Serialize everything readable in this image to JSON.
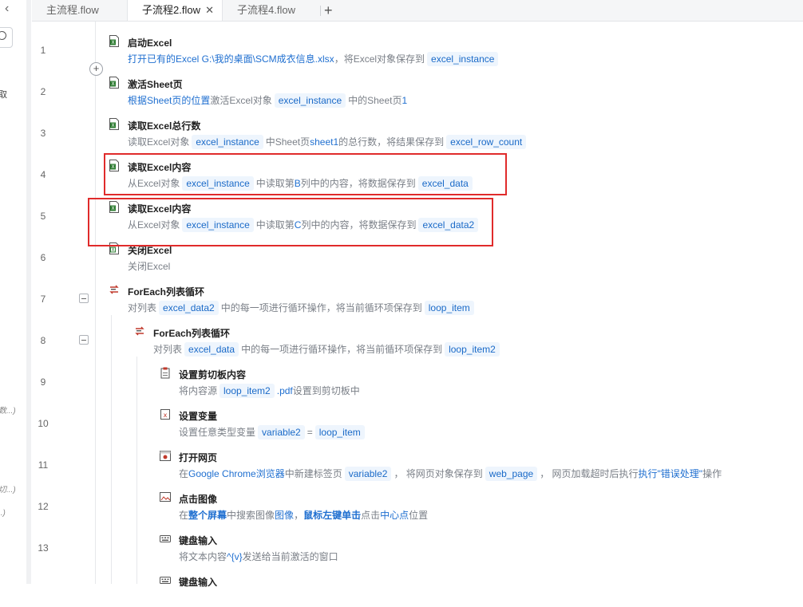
{
  "left_panel": {
    "fragments": [
      "取",
      "数...)",
      "切...)",
      "..)"
    ]
  },
  "tabs": [
    {
      "label": "主流程.flow",
      "active": false
    },
    {
      "label": "子流程2.flow",
      "active": true,
      "close": "✕"
    },
    {
      "label": "子流程4.flow",
      "active": false
    }
  ],
  "add_tab": "+",
  "add_step": "+",
  "steps": [
    {
      "line": "1",
      "title": "启动Excel",
      "desc": [
        {
          "t": "打开已有的Excel G:\\我的桌面\\SCM成衣信息.xlsx",
          "s": "lnk"
        },
        {
          "t": "，将Excel对象保存到",
          "s": ""
        },
        {
          "t": "excel_instance",
          "s": "pill"
        }
      ]
    },
    {
      "line": "2",
      "title": "激活Sheet页",
      "desc": [
        {
          "t": "根据Sheet页的位置",
          "s": "lnk"
        },
        {
          "t": "激活Excel对象",
          "s": ""
        },
        {
          "t": "excel_instance",
          "s": "pill"
        },
        {
          "t": "中的Sheet页",
          "s": ""
        },
        {
          "t": "1",
          "s": "lnk"
        }
      ]
    },
    {
      "line": "3",
      "title": "读取Excel总行数",
      "desc": [
        {
          "t": "读取Excel对象",
          "s": ""
        },
        {
          "t": "excel_instance",
          "s": "pill"
        },
        {
          "t": "中Sheet页",
          "s": ""
        },
        {
          "t": "sheet1",
          "s": "lnk"
        },
        {
          "t": "的总行数，将结果保存到",
          "s": ""
        },
        {
          "t": "excel_row_count",
          "s": "pill"
        }
      ]
    },
    {
      "line": "4",
      "title": "读取Excel内容",
      "desc": [
        {
          "t": "从Excel对象",
          "s": ""
        },
        {
          "t": "excel_instance",
          "s": "pill"
        },
        {
          "t": "中读取第",
          "s": ""
        },
        {
          "t": "B",
          "s": "lnk"
        },
        {
          "t": "列中的内容，将数据保存到",
          "s": ""
        },
        {
          "t": "excel_data",
          "s": "pill"
        }
      ]
    },
    {
      "line": "5",
      "title": "读取Excel内容",
      "desc": [
        {
          "t": "从Excel对象",
          "s": ""
        },
        {
          "t": "excel_instance",
          "s": "pill"
        },
        {
          "t": "中读取第",
          "s": ""
        },
        {
          "t": "C",
          "s": "lnk"
        },
        {
          "t": "列中的内容，将数据保存到",
          "s": ""
        },
        {
          "t": "excel_data2",
          "s": "pill"
        }
      ]
    },
    {
      "line": "6",
      "title": "关闭Excel",
      "desc": [
        {
          "t": "关闭Excel",
          "s": ""
        }
      ]
    },
    {
      "line": "7",
      "title": "ForEach列表循环",
      "desc": [
        {
          "t": "对列表",
          "s": ""
        },
        {
          "t": "excel_data2",
          "s": "pill"
        },
        {
          "t": "中的每一项进行循环操作，将当前循环项保存到",
          "s": ""
        },
        {
          "t": "loop_item",
          "s": "pill"
        }
      ]
    },
    {
      "line": "8",
      "title": "ForEach列表循环",
      "desc": [
        {
          "t": "对列表",
          "s": ""
        },
        {
          "t": "excel_data",
          "s": "pill"
        },
        {
          "t": "中的每一项进行循环操作，将当前循环项保存到",
          "s": ""
        },
        {
          "t": "loop_item2",
          "s": "pill"
        }
      ]
    },
    {
      "line": "9",
      "title": "设置剪切板内容",
      "desc": [
        {
          "t": "将内容源",
          "s": ""
        },
        {
          "t": "loop_item2",
          "s": "pill"
        },
        {
          "t": ".pdf",
          "s": "lnk"
        },
        {
          "t": "设置到剪切板中",
          "s": ""
        }
      ]
    },
    {
      "line": "10",
      "title": "设置变量",
      "desc": [
        {
          "t": "设置任意类型变量",
          "s": ""
        },
        {
          "t": "variable2",
          "s": "pill"
        },
        {
          "t": "=",
          "s": ""
        },
        {
          "t": "loop_item",
          "s": "pill"
        }
      ]
    },
    {
      "line": "11",
      "title": "打开网页",
      "desc": [
        {
          "t": "在",
          "s": ""
        },
        {
          "t": "Google Chrome浏览器",
          "s": "lnk"
        },
        {
          "t": "中新建标签页",
          "s": ""
        },
        {
          "t": "variable2",
          "s": "pill"
        },
        {
          "t": "， 将网页对象保存到",
          "s": ""
        },
        {
          "t": "web_page",
          "s": "pill"
        },
        {
          "t": "， 网页加载超时后执行",
          "s": ""
        },
        {
          "t": "执行\"错误处理\"",
          "s": "lnk"
        },
        {
          "t": "操作",
          "s": ""
        }
      ]
    },
    {
      "line": "12",
      "title": "点击图像",
      "desc": [
        {
          "t": "在",
          "s": ""
        },
        {
          "t": "整个屏幕",
          "s": "bd"
        },
        {
          "t": "中搜索图像",
          "s": ""
        },
        {
          "t": "图像",
          "s": "lnk"
        },
        {
          "t": "，",
          "s": ""
        },
        {
          "t": "鼠标左键单击",
          "s": "bd"
        },
        {
          "t": "点击",
          "s": ""
        },
        {
          "t": "中心点",
          "s": "lnk"
        },
        {
          "t": "位置",
          "s": ""
        }
      ]
    },
    {
      "line": "13",
      "title": "键盘输入",
      "desc": [
        {
          "t": "将文本内容",
          "s": ""
        },
        {
          "t": "^{v}",
          "s": "lnk"
        },
        {
          "t": "发送给当前激活的窗口",
          "s": ""
        }
      ]
    },
    {
      "line": "",
      "title": "键盘输入",
      "desc": []
    }
  ],
  "colors": {
    "accent": "#1f6fd0",
    "pill_bg": "#eef5fd",
    "highlight": "#e02b2b"
  }
}
